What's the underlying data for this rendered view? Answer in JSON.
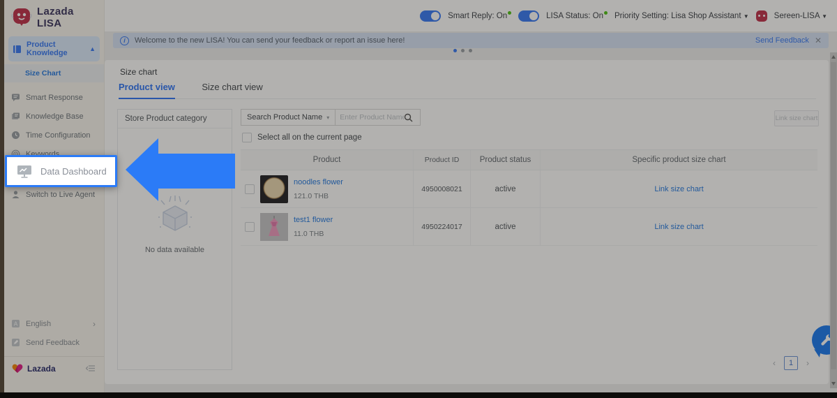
{
  "colors": {
    "accent": "#3d7cf5",
    "highlight": "#2b7bf7",
    "green": "#52c41a"
  },
  "logo": {
    "line1": "Lazada",
    "line2": "LISA"
  },
  "topbar": {
    "smart_reply_label": "Smart Reply:",
    "smart_reply_state": "On",
    "lisa_status_label": "LISA Status:",
    "lisa_status_state": "On",
    "priority_label": "Priority Setting: Lisa Shop Assistant",
    "account_name": "Sereen-LISA"
  },
  "banner": {
    "message": "Welcome to the new LISA! You can send your feedback or report an issue here!",
    "action": "Send Feedback"
  },
  "sidebar": {
    "product_knowledge": "Product Knowledge",
    "size_chart": "Size Chart",
    "smart_response": "Smart Response",
    "knowledge_base": "Knowledge Base",
    "time_configuration": "Time Configuration",
    "keywords": "Keywords",
    "data_dashboard": "Data Dashboard",
    "switch_live_agent": "Switch to Live Agent",
    "english": "English",
    "send_feedback": "Send Feedback",
    "brand": "Lazada"
  },
  "main": {
    "title": "Size chart",
    "tab_product_view": "Product view",
    "tab_size_chart_view": "Size chart view",
    "panel_header": "Store Product category",
    "no_data": "No data available",
    "search_dropdown": "Search Product Name",
    "search_placeholder": "Enter Product Name to se...",
    "link_button": "Link size chart",
    "select_all": "Select all on the current page",
    "table": {
      "headers": [
        "Product",
        "Product ID",
        "Product status",
        "Specific product size chart"
      ],
      "rows": [
        {
          "name": "noodles flower",
          "price": "121.0 THB",
          "id": "4950008021",
          "status": "active",
          "action": "Link size chart"
        },
        {
          "name": "test1 flower",
          "price": "11.0 THB",
          "id": "4950224017",
          "status": "active",
          "action": "Link size chart"
        }
      ]
    },
    "page": "1"
  }
}
